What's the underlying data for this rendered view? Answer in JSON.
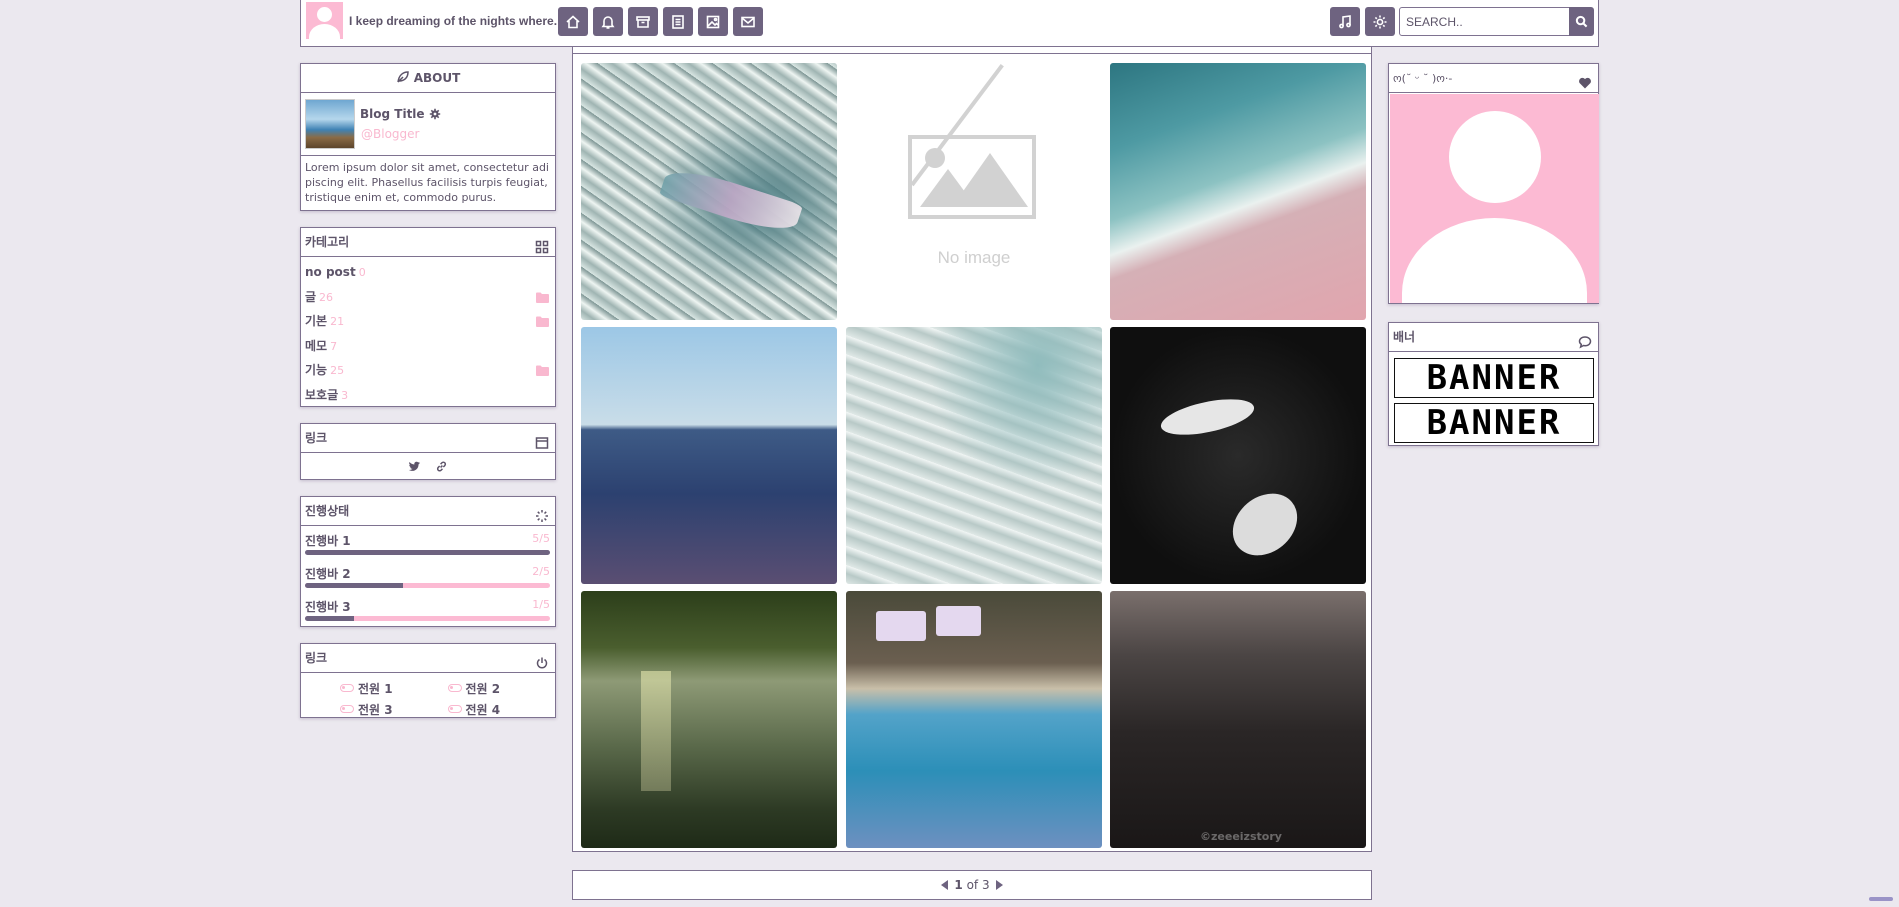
{
  "header": {
    "site_title": "I keep dreaming of the nights where.",
    "search_placeholder": "SEARCH..",
    "nav_icons": [
      "home-icon",
      "bell-icon",
      "archive-icon",
      "document-icon",
      "image-icon",
      "mail-icon"
    ],
    "right_icons": [
      "music-icon",
      "sun-icon"
    ]
  },
  "about": {
    "heading": "ABOUT",
    "blog_title": "Blog Title",
    "username": "@Blogger",
    "description": "Lorem ipsum dolor sit amet, consectetur adipiscing elit. Phasellus facilisis turpis feugiat, tristique enim et, commodo purus."
  },
  "category": {
    "heading": "카테고리",
    "items": [
      {
        "name": "no post",
        "count": "0",
        "folder": false
      },
      {
        "name": "글",
        "count": "26",
        "folder": true
      },
      {
        "name": "기본",
        "count": "21",
        "folder": true
      },
      {
        "name": "메모",
        "count": "7",
        "folder": false
      },
      {
        "name": "기능",
        "count": "25",
        "folder": true
      },
      {
        "name": "보호글",
        "count": "3",
        "folder": false
      }
    ]
  },
  "links": {
    "heading": "링크",
    "icons": [
      "twitter-icon",
      "link-icon"
    ]
  },
  "progress": {
    "heading": "진행상태",
    "bars": [
      {
        "label": "진행바 1",
        "value": "5/5",
        "fraction": 1.0
      },
      {
        "label": "진행바 2",
        "value": "2/5",
        "fraction": 0.4
      },
      {
        "label": "진행바 3",
        "value": "1/5",
        "fraction": 0.2
      }
    ]
  },
  "power": {
    "heading": "링크",
    "items": [
      "전원 1",
      "전원 2",
      "전원 3",
      "전원 4"
    ]
  },
  "grid": {
    "no_image_text": "No image",
    "watermark": "©zeeeizstory"
  },
  "pager": {
    "current": "1",
    "total_text": "of 3"
  },
  "profile": {
    "heading": "ო(˘ ᵕ ˘ )ო‧-"
  },
  "banners": {
    "heading": "배너",
    "items": [
      "BANNER",
      "BANNER"
    ]
  },
  "colors": {
    "accent_pink": "#f9b8cf",
    "primary_purple": "#6e6380",
    "border": "#7e7290",
    "background": "#ebe8ef"
  }
}
